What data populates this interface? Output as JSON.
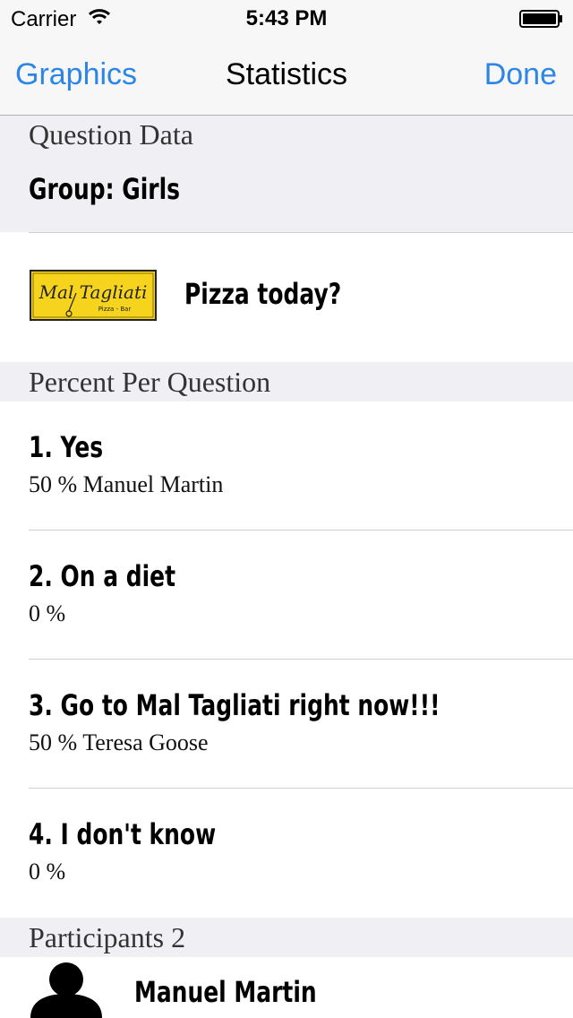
{
  "status": {
    "carrier": "Carrier",
    "time": "5:43 PM"
  },
  "nav": {
    "left": "Graphics",
    "title": "Statistics",
    "right": "Done"
  },
  "question_data": {
    "header": "Question Data",
    "group": "Group: Girls",
    "question": "Pizza today?",
    "logo_text": "Mal Tagliati",
    "logo_subtext": "Pizza - Bar"
  },
  "percent": {
    "header": "Percent Per Question",
    "items": [
      {
        "title": "1. Yes",
        "detail": "50 % Manuel Martin"
      },
      {
        "title": "2. On a diet",
        "detail": "0 %"
      },
      {
        "title": "3. Go to Mal Tagliati right now!!!",
        "detail": "50 % Teresa Goose"
      },
      {
        "title": "4. I don't know",
        "detail": "0 %"
      }
    ]
  },
  "participants": {
    "header": "Participants 2",
    "items": [
      {
        "name": "Manuel Martin"
      }
    ]
  },
  "colors": {
    "accent": "#2d86e6",
    "section_bg": "#efeff4",
    "logo_yellow": "#f6d31c"
  },
  "icons": {
    "wifi": "wifi-icon",
    "battery": "battery-icon",
    "avatar": "person-silhouette-icon"
  }
}
